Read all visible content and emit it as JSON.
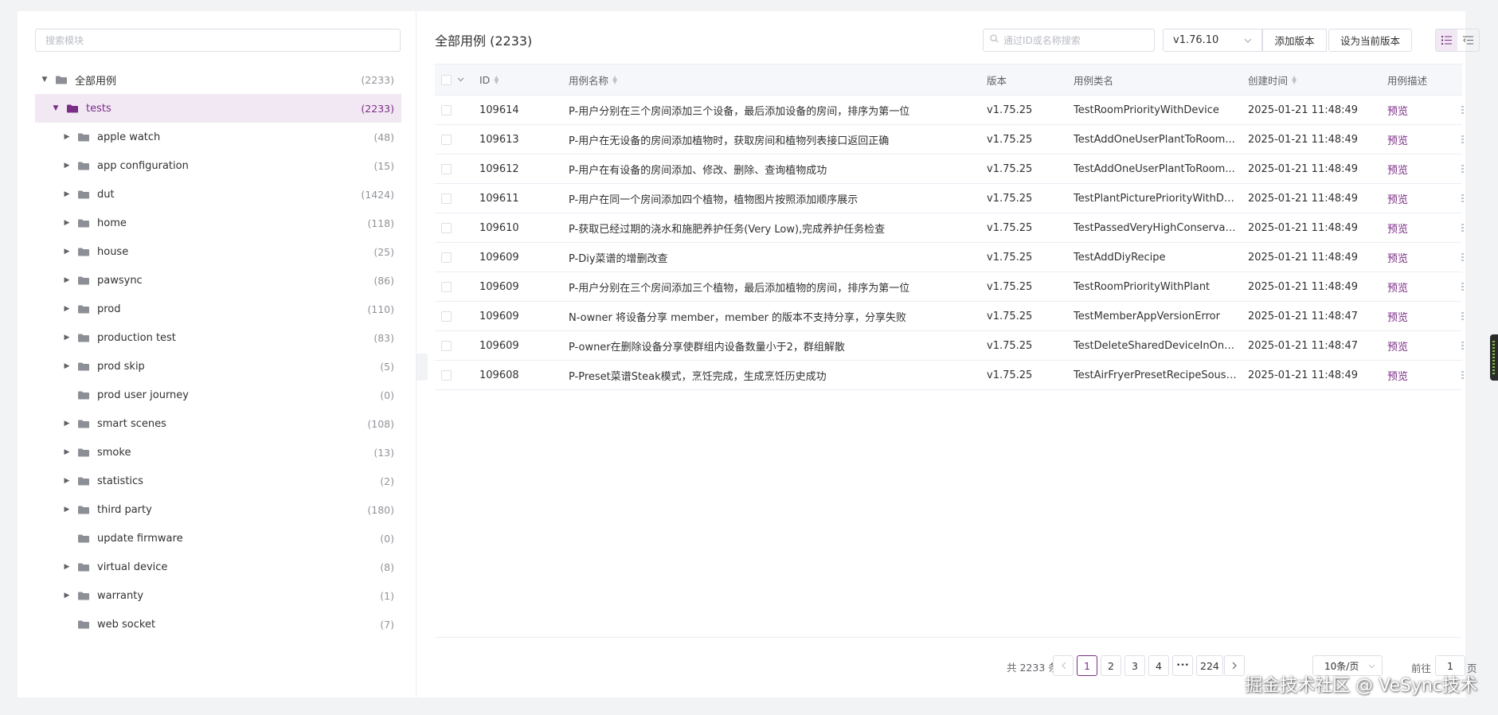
{
  "tree": {
    "search_placeholder": "搜索模块",
    "root": {
      "label": "全部用例",
      "count": "(2233)"
    },
    "selected": {
      "label": "tests",
      "count": "(2233)"
    },
    "children": [
      {
        "label": "apple watch",
        "count": "(48)",
        "has_children": true
      },
      {
        "label": "app configuration",
        "count": "(15)",
        "has_children": true
      },
      {
        "label": "dut",
        "count": "(1424)",
        "has_children": true
      },
      {
        "label": "home",
        "count": "(118)",
        "has_children": true
      },
      {
        "label": "house",
        "count": "(25)",
        "has_children": true
      },
      {
        "label": "pawsync",
        "count": "(86)",
        "has_children": true
      },
      {
        "label": "prod",
        "count": "(110)",
        "has_children": true
      },
      {
        "label": "production test",
        "count": "(83)",
        "has_children": true
      },
      {
        "label": "prod skip",
        "count": "(5)",
        "has_children": true
      },
      {
        "label": "prod user journey",
        "count": "(0)",
        "has_children": false
      },
      {
        "label": "smart scenes",
        "count": "(108)",
        "has_children": true
      },
      {
        "label": "smoke",
        "count": "(13)",
        "has_children": true
      },
      {
        "label": "statistics",
        "count": "(2)",
        "has_children": true
      },
      {
        "label": "third party",
        "count": "(180)",
        "has_children": true
      },
      {
        "label": "update firmware",
        "count": "(0)",
        "has_children": false
      },
      {
        "label": "virtual device",
        "count": "(8)",
        "has_children": true
      },
      {
        "label": "warranty",
        "count": "(1)",
        "has_children": true
      },
      {
        "label": "web socket",
        "count": "(7)",
        "has_children": false
      }
    ]
  },
  "header": {
    "title": "全部用例 (2233)",
    "search_placeholder": "通过ID或名称搜索",
    "version_selected": "v1.76.10",
    "add_version_label": "添加版本",
    "set_current_label": "设为当前版本"
  },
  "table": {
    "columns": {
      "id": "ID",
      "name": "用例名称",
      "version": "版本",
      "class": "用例类名",
      "created": "创建时间",
      "desc": "用例描述"
    },
    "rows": [
      {
        "id": "109614",
        "name": "P-用户分别在三个房间添加三个设备，最后添加设备的房间，排序为第一位",
        "version": "v1.75.25",
        "class": "TestRoomPriorityWithDevice",
        "created": "2025-01-21 11:48:49",
        "desc": "预览"
      },
      {
        "id": "109613",
        "name": "P-用户在无设备的房间添加植物时，获取房间和植物列表接口返回正确",
        "version": "v1.75.25",
        "class": "TestAddOneUserPlantToRoom...",
        "created": "2025-01-21 11:48:49",
        "desc": "预览"
      },
      {
        "id": "109612",
        "name": "P-用户在有设备的房间添加、修改、删除、查询植物成功",
        "version": "v1.75.25",
        "class": "TestAddOneUserPlantToRoom...",
        "created": "2025-01-21 11:48:49",
        "desc": "预览"
      },
      {
        "id": "109611",
        "name": "P-用户在同一个房间添加四个植物，植物图片按照添加顺序展示",
        "version": "v1.75.25",
        "class": "TestPlantPicturePriorityWithDe...",
        "created": "2025-01-21 11:48:49",
        "desc": "预览"
      },
      {
        "id": "109610",
        "name": "P-获取已经过期的浇水和施肥养护任务(Very Low),完成养护任务检查",
        "version": "v1.75.25",
        "class": "TestPassedVeryHighConservati...",
        "created": "2025-01-21 11:48:49",
        "desc": "预览"
      },
      {
        "id": "109609",
        "name": "P-Diy菜谱的增删改查",
        "version": "v1.75.25",
        "class": "TestAddDiyRecipe",
        "created": "2025-01-21 11:48:49",
        "desc": "预览"
      },
      {
        "id": "109609",
        "name": "P-用户分别在三个房间添加三个植物，最后添加植物的房间，排序为第一位",
        "version": "v1.75.25",
        "class": "TestRoomPriorityWithPlant",
        "created": "2025-01-21 11:48:49",
        "desc": "预览"
      },
      {
        "id": "109609",
        "name": "N-owner 将设备分享 member，member 的版本不支持分享，分享失败",
        "version": "v1.75.25",
        "class": "TestMemberAppVersionError",
        "created": "2025-01-21 11:48:47",
        "desc": "预览"
      },
      {
        "id": "109609",
        "name": "P-owner在删除设备分享使群组内设备数量小于2，群组解散",
        "version": "v1.75.25",
        "class": "TestDeleteSharedDeviceInOne...",
        "created": "2025-01-21 11:48:47",
        "desc": "预览"
      },
      {
        "id": "109608",
        "name": "P-Preset菜谱Steak模式，烹饪完成，生成烹饪历史成功",
        "version": "v1.75.25",
        "class": "TestAirFryerPresetRecipeSousVi...",
        "created": "2025-01-21 11:48:49",
        "desc": "预览"
      }
    ]
  },
  "pagination": {
    "total": "共 2233 条",
    "pages": [
      "1",
      "2",
      "3",
      "4"
    ],
    "ellipsis": "•••",
    "last_page": "224",
    "page_size": "10条/页",
    "goto_label": "前往",
    "goto_value": "1",
    "goto_suffix": "页"
  },
  "watermark": "掘金技术社区 @ VeSync技术",
  "colors": {
    "accent": "#7b2e86",
    "selected_bg": "#f1e8f3"
  }
}
